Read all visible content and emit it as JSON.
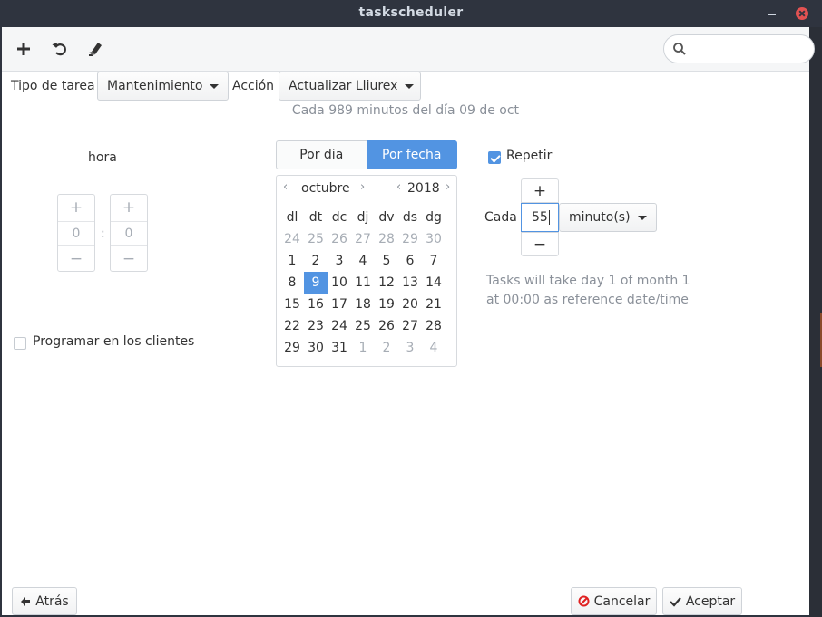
{
  "window": {
    "title": "taskscheduler"
  },
  "toolbar": {
    "add_icon": "plus-icon",
    "undo_icon": "undo-icon",
    "clear_icon": "eraser-icon",
    "search_placeholder": "",
    "search_value": ""
  },
  "task_type": {
    "label": "Tipo de tarea",
    "value": "Mantenimiento"
  },
  "action": {
    "label": "Acción",
    "value": "Actualizar Lliurex"
  },
  "summary": "Cada 989  minutos del día 09 de oct",
  "time": {
    "label": "hora",
    "separator": ":",
    "hour": "0",
    "minute": "0",
    "plus": "+",
    "minus": "−"
  },
  "mode_tabs": [
    {
      "label": "Por dia",
      "active": false
    },
    {
      "label": "Por fecha",
      "active": true
    }
  ],
  "calendar": {
    "month": "octubre",
    "year": "2018",
    "prev": "‹",
    "next": "›",
    "weekdays": [
      "dl",
      "dt",
      "dc",
      "dj",
      "dv",
      "ds",
      "dg"
    ],
    "weeks": [
      [
        {
          "d": "24",
          "dim": true
        },
        {
          "d": "25",
          "dim": true
        },
        {
          "d": "26",
          "dim": true
        },
        {
          "d": "27",
          "dim": true
        },
        {
          "d": "28",
          "dim": true
        },
        {
          "d": "29",
          "dim": true
        },
        {
          "d": "30",
          "dim": true
        }
      ],
      [
        {
          "d": "1"
        },
        {
          "d": "2"
        },
        {
          "d": "3"
        },
        {
          "d": "4"
        },
        {
          "d": "5"
        },
        {
          "d": "6"
        },
        {
          "d": "7"
        }
      ],
      [
        {
          "d": "8"
        },
        {
          "d": "9",
          "selected": true
        },
        {
          "d": "10"
        },
        {
          "d": "11"
        },
        {
          "d": "12"
        },
        {
          "d": "13"
        },
        {
          "d": "14"
        }
      ],
      [
        {
          "d": "15"
        },
        {
          "d": "16"
        },
        {
          "d": "17"
        },
        {
          "d": "18"
        },
        {
          "d": "19"
        },
        {
          "d": "20"
        },
        {
          "d": "21"
        }
      ],
      [
        {
          "d": "22"
        },
        {
          "d": "23"
        },
        {
          "d": "24"
        },
        {
          "d": "25"
        },
        {
          "d": "26"
        },
        {
          "d": "27"
        },
        {
          "d": "28"
        }
      ],
      [
        {
          "d": "29"
        },
        {
          "d": "30"
        },
        {
          "d": "31"
        },
        {
          "d": "1",
          "dim": true
        },
        {
          "d": "2",
          "dim": true
        },
        {
          "d": "3",
          "dim": true
        },
        {
          "d": "4",
          "dim": true
        }
      ]
    ]
  },
  "clients": {
    "label": "Programar en los clientes",
    "checked": false
  },
  "repeat": {
    "label": "Repetir",
    "checked": true,
    "every_label": "Cada",
    "value": "55",
    "unit": "minuto(s)",
    "plus": "+",
    "minus": "−",
    "note_line1": "Tasks will take day 1 of month 1",
    "note_line2": "at 00:00 as reference date/time"
  },
  "footer": {
    "back": "Atrás",
    "cancel": "Cancelar",
    "accept": "Aceptar"
  },
  "colors": {
    "accent": "#5294e2",
    "titlebar": "#2f343f",
    "close": "#e25252"
  }
}
